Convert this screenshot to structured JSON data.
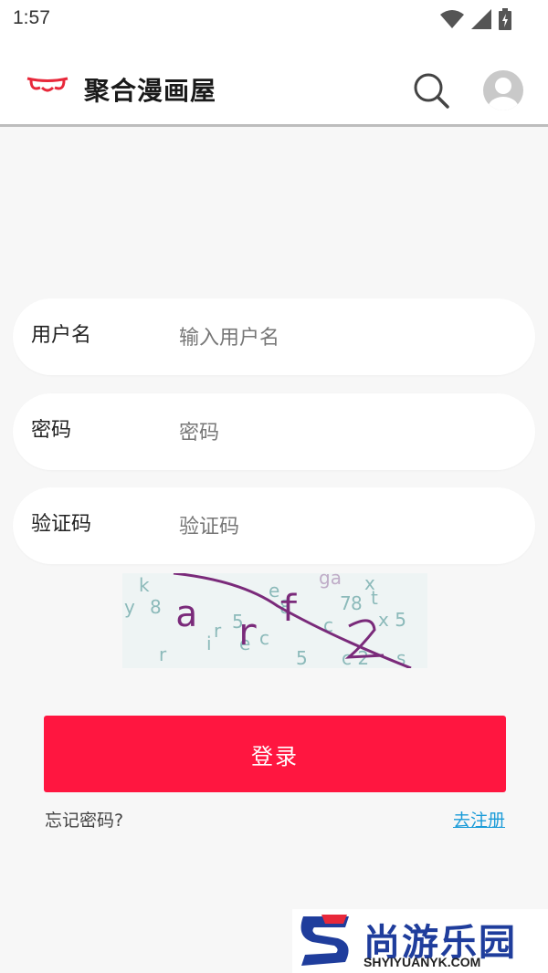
{
  "status_bar": {
    "time": "1:57"
  },
  "app_bar": {
    "title": "聚合漫画屋"
  },
  "form": {
    "username": {
      "label": "用户名",
      "placeholder": "输入用户名"
    },
    "password": {
      "label": "密码",
      "placeholder": "密码"
    },
    "captcha": {
      "label": "验证码",
      "placeholder": "验证码",
      "image_text": "arf2"
    },
    "login_label": "登录",
    "forgot_label": "忘记密码?",
    "register_label": "去注册"
  },
  "watermark": {
    "brand": "尚游乐园",
    "url": "SHYIYUANYK.COM"
  },
  "colors": {
    "accent": "#ff1640",
    "link": "#1a9bd8",
    "background": "#f7f7f7"
  },
  "icons": [
    "wifi-icon",
    "signal-icon",
    "battery-icon",
    "logo-icon",
    "search-icon",
    "avatar-icon"
  ]
}
